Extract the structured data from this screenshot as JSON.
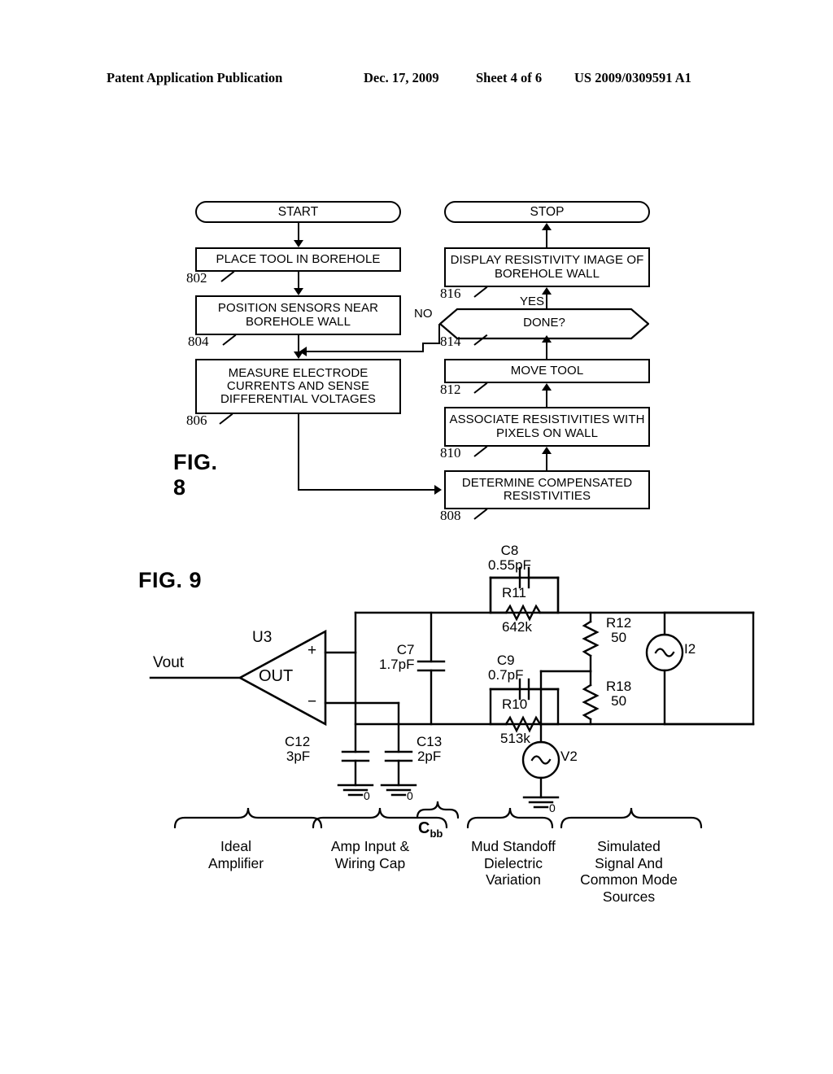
{
  "header": {
    "publication": "Patent Application Publication",
    "date": "Dec. 17, 2009",
    "sheet": "Sheet 4 of 6",
    "number": "US 2009/0309591 A1"
  },
  "figure8": {
    "label": "FIG. 8",
    "start_label": "START",
    "stop_label": "STOP",
    "yes_label": "YES",
    "no_label": "NO",
    "steps": [
      {
        "ref": "802",
        "text": "PLACE TOOL IN BOREHOLE"
      },
      {
        "ref": "804",
        "text": "POSITION SENSORS NEAR BOREHOLE WALL"
      },
      {
        "ref": "806",
        "text": "MEASURE ELECTRODE CURRENTS AND SENSE DIFFERENTIAL VOLTAGES"
      },
      {
        "ref": "808",
        "text": "DETERMINE COMPENSATED RESISTIVITIES"
      },
      {
        "ref": "810",
        "text": "ASSOCIATE RESISTIVITIES WITH PIXELS ON WALL"
      },
      {
        "ref": "812",
        "text": "MOVE TOOL"
      },
      {
        "ref": "814",
        "text": "DONE?"
      },
      {
        "ref": "816",
        "text": "DISPLAY RESISTIVITY IMAGE OF BOREHOLE WALL"
      }
    ]
  },
  "figure9": {
    "label": "FIG. 9",
    "vout_label": "Vout",
    "opamp": {
      "designator": "U3",
      "out_label": "OUT",
      "plus": "+",
      "minus": "−"
    },
    "components": [
      {
        "designator": "C8",
        "value": "0.55pF"
      },
      {
        "designator": "R11",
        "value": "642k"
      },
      {
        "designator": "C9",
        "value": "0.7pF"
      },
      {
        "designator": "R10",
        "value": "513k"
      },
      {
        "designator": "C7",
        "value": "1.7pF"
      },
      {
        "designator": "C12",
        "value": "3pF"
      },
      {
        "designator": "C13",
        "value": "2pF"
      },
      {
        "designator": "R12",
        "value": "50"
      },
      {
        "designator": "R18",
        "value": "50"
      },
      {
        "designator": "I2",
        "value": ""
      },
      {
        "designator": "V2",
        "value": ""
      }
    ],
    "ground_label": "0",
    "cbb_label": "C",
    "cbb_sub": "bb",
    "braces": [
      {
        "caption": "Ideal\nAmplifier"
      },
      {
        "caption": "Amp Input &\nWiring Cap"
      },
      {
        "caption": "Mud Standoff\nDielectric\nVariation"
      },
      {
        "caption": "Simulated\nSignal And\nCommon Mode\nSources"
      }
    ]
  }
}
